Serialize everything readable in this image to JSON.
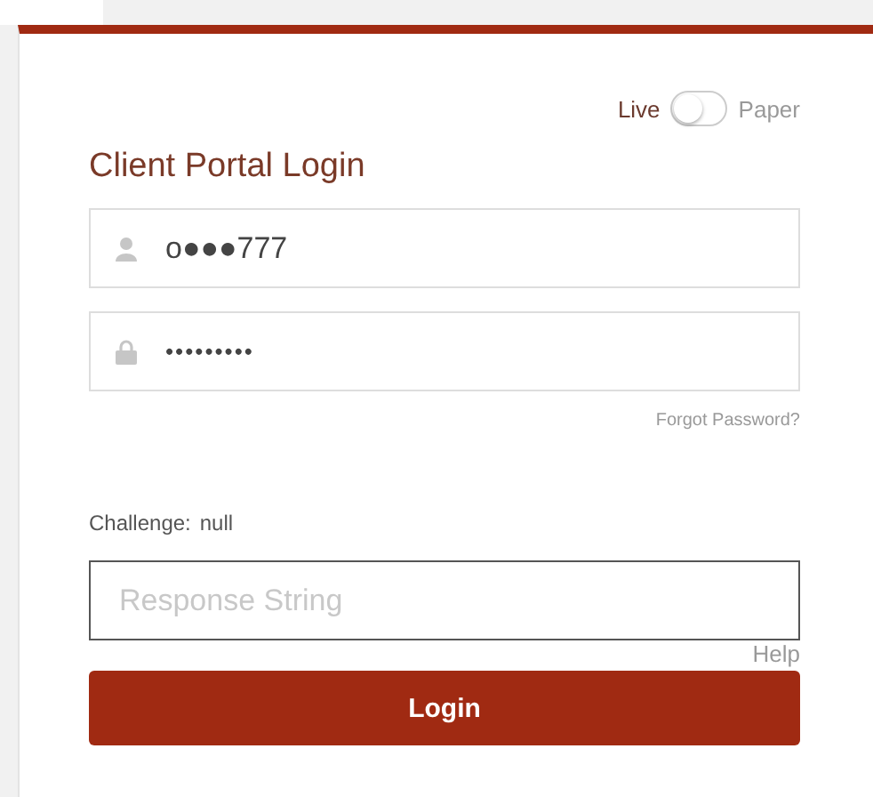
{
  "mode_toggle": {
    "left_label": "Live",
    "right_label": "Paper",
    "on": false
  },
  "title": "Client Portal Login",
  "username": {
    "value": "o●●●777"
  },
  "password": {
    "value": "•••••••••"
  },
  "forgot_link": "Forgot Password?",
  "challenge": {
    "label": "Challenge:",
    "value": "null"
  },
  "response": {
    "placeholder": "Response String"
  },
  "help_link": "Help",
  "login_button": "Login"
}
